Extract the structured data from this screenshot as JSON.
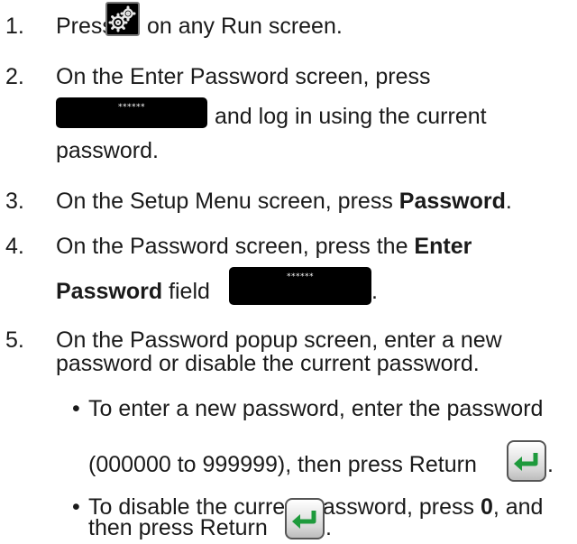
{
  "steps": [
    {
      "num": "1.",
      "pre": "Press",
      "post": "on any Run screen."
    },
    {
      "num": "2.",
      "line1": "On the Enter Password screen, press",
      "mid": "and log in using the current",
      "line3": "password."
    },
    {
      "num": "3.",
      "pre": "On the Setup Menu screen, press ",
      "bold": "Password",
      "post": "."
    },
    {
      "num": "4.",
      "line1_pre": "On the Password screen, press the ",
      "line1_bold": "Enter",
      "line2_bold": "Password",
      "line2_post": " field",
      "end": "."
    },
    {
      "num": "5.",
      "line1": "On the Password popup screen, enter a new",
      "line2": "password or disable the current password."
    }
  ],
  "bullets": [
    {
      "symbol": "•",
      "line1": "To enter a new password, enter the password",
      "line2": "(000000 to 999999), then press Return",
      "end": "."
    },
    {
      "symbol": "•",
      "line1_pre": "To disable the current password, press ",
      "line1_bold": "0",
      "line1_post": ", and",
      "line2": "then press Return",
      "end": "."
    }
  ],
  "password_mask": "******",
  "icons": {
    "settings": "gears-icon",
    "return": "return-enter-icon"
  },
  "colors": {
    "return_arrow": "#1e9a3c",
    "field_bg": "#000000",
    "gear_bg": "#000000"
  }
}
